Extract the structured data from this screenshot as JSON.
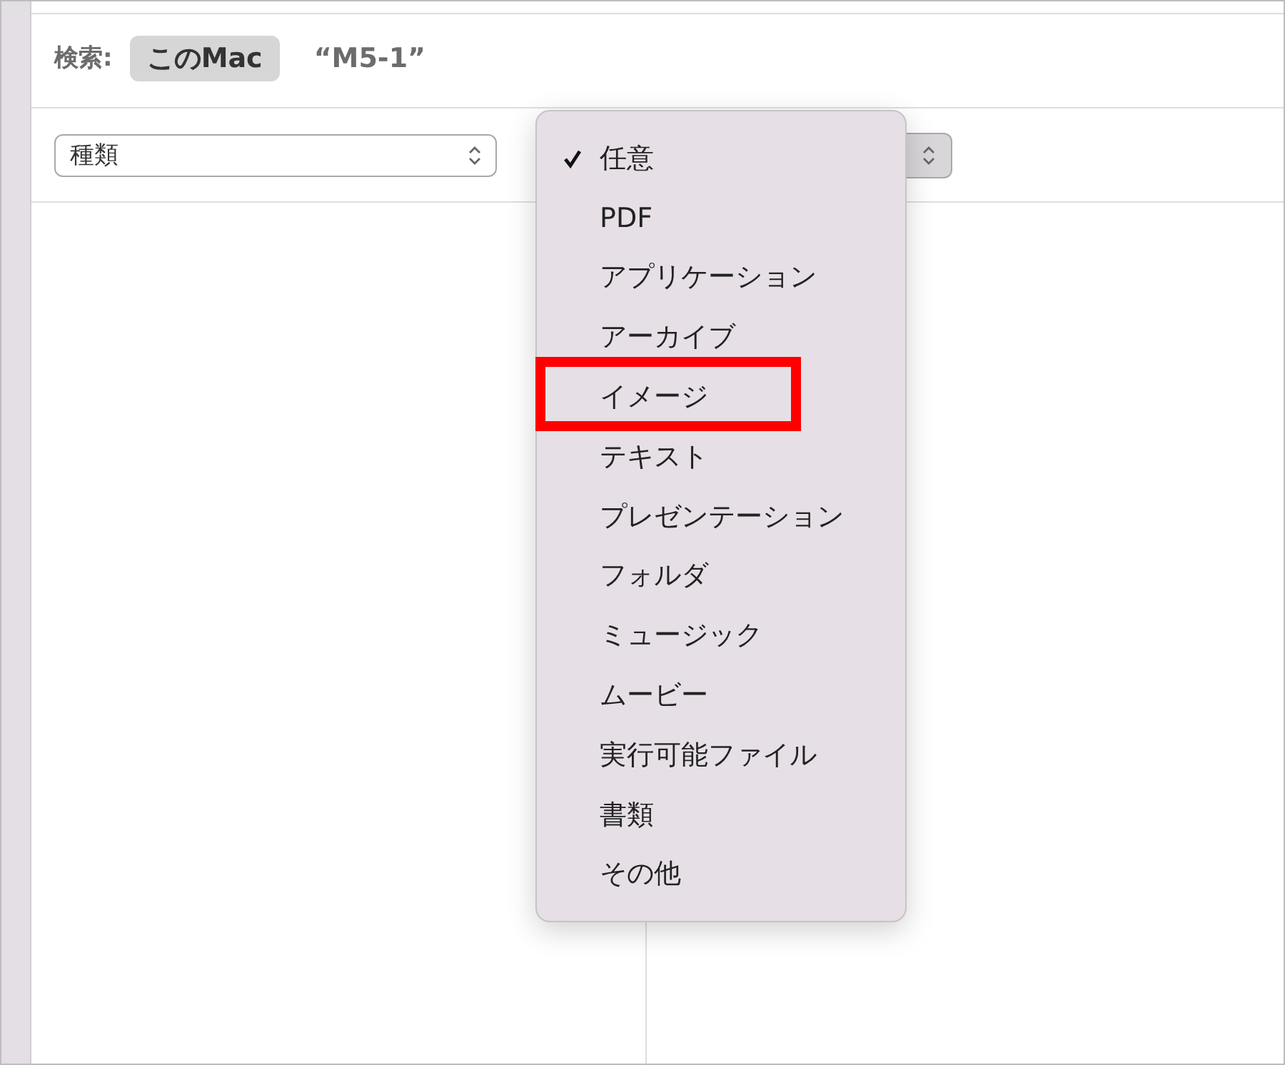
{
  "search_bar": {
    "label": "検索:",
    "scopes": [
      {
        "label": "このMac",
        "selected": true
      },
      {
        "label": "“M5-1”",
        "selected": false
      }
    ]
  },
  "criteria": {
    "attribute": "種類"
  },
  "menu": {
    "items": [
      {
        "label": "任意",
        "checked": true,
        "annotated": false
      },
      {
        "label": "PDF",
        "checked": false,
        "annotated": false
      },
      {
        "label": "アプリケーション",
        "checked": false,
        "annotated": false
      },
      {
        "label": "アーカイブ",
        "checked": false,
        "annotated": false
      },
      {
        "label": "イメージ",
        "checked": false,
        "annotated": true
      },
      {
        "label": "テキスト",
        "checked": false,
        "annotated": false
      },
      {
        "label": "プレゼンテーション",
        "checked": false,
        "annotated": false
      },
      {
        "label": "フォルダ",
        "checked": false,
        "annotated": false
      },
      {
        "label": "ミュージック",
        "checked": false,
        "annotated": false
      },
      {
        "label": "ムービー",
        "checked": false,
        "annotated": false
      },
      {
        "label": "実行可能ファイル",
        "checked": false,
        "annotated": false
      },
      {
        "label": "書類",
        "checked": false,
        "annotated": false
      },
      {
        "label": "その他",
        "checked": false,
        "annotated": false
      }
    ]
  }
}
